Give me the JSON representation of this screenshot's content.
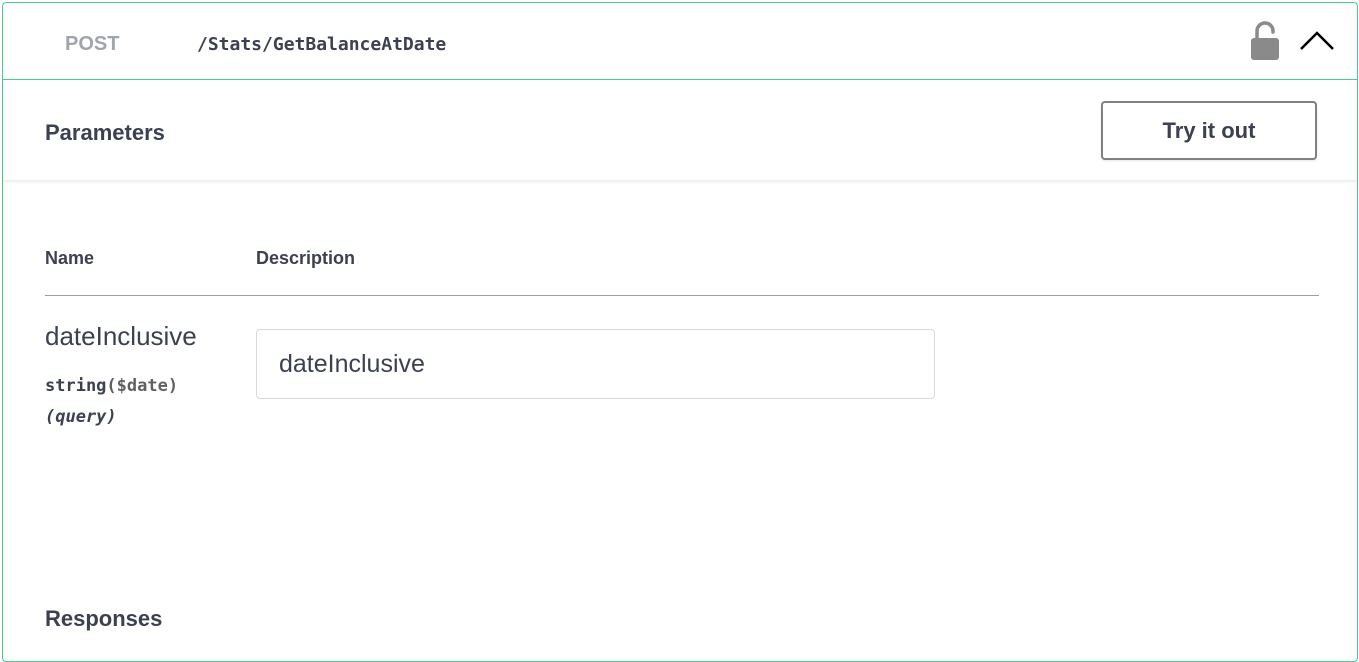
{
  "endpoint": {
    "method": "POST",
    "path": "/Stats/GetBalanceAtDate",
    "lock_icon": "unlocked-padlock-icon",
    "collapse_icon": "chevron-up-icon",
    "accent_color": "#49cc90"
  },
  "parameters": {
    "title": "Parameters",
    "try_button_label": "Try it out",
    "columns": {
      "name": "Name",
      "description": "Description"
    },
    "items": [
      {
        "name": "dateInclusive",
        "type": "string",
        "format": "($date)",
        "location": "(query)",
        "placeholder": "dateInclusive",
        "value": ""
      }
    ]
  },
  "responses": {
    "title": "Responses"
  }
}
